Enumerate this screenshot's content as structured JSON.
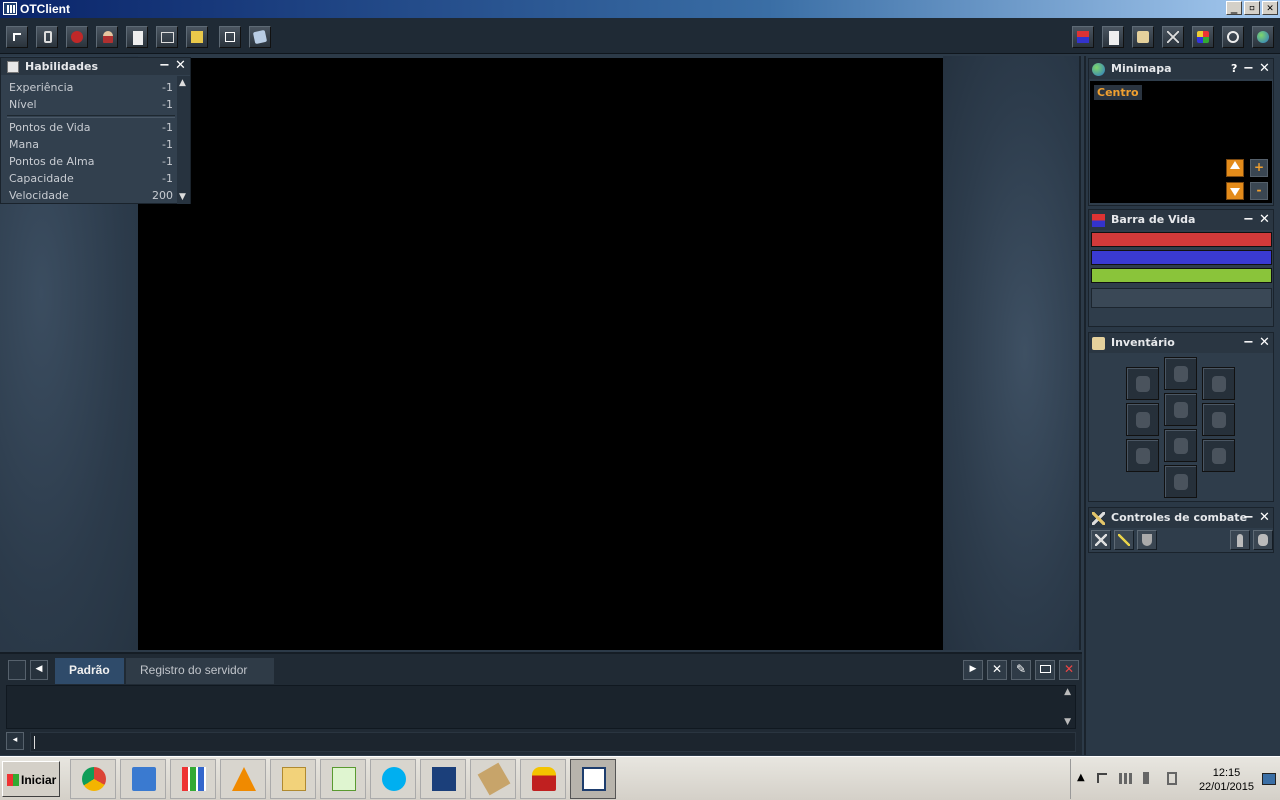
{
  "window": {
    "title": "OTClient",
    "controls": [
      "_",
      "▫",
      "✕"
    ]
  },
  "toolbar": {
    "left_buttons": [
      "pointer-icon",
      "hand-icon",
      "logout-icon",
      "character-icon",
      "notes-icon",
      "console-icon",
      "box-icon",
      "move-icon",
      "map-icon"
    ],
    "right_buttons": [
      "health-bar-icon",
      "skills-icon",
      "inventory-icon",
      "combat-icon",
      "spells-icon",
      "options-icon",
      "minimap-icon"
    ]
  },
  "skills_panel": {
    "title": "Habilidades",
    "rows": [
      {
        "label": "Experiência",
        "value": "-1"
      },
      {
        "label": "Nível",
        "value": "-1"
      },
      {
        "label": "Pontos de Vida",
        "value": "-1"
      },
      {
        "label": "Mana",
        "value": "-1"
      },
      {
        "label": "Pontos de Alma",
        "value": "-1"
      },
      {
        "label": "Capacidade",
        "value": "-1"
      },
      {
        "label": "Velocidade",
        "value": "200"
      }
    ]
  },
  "minimap": {
    "title": "Minimapa",
    "help": "?",
    "center_label": "Centro",
    "zoom_in": "+",
    "zoom_out": "-"
  },
  "health_bar": {
    "title": "Barra de Vida",
    "colors": {
      "health": "#d23a3a",
      "mana": "#3a3ad2",
      "soul": "#8ac43a"
    }
  },
  "inventory": {
    "title": "Inventário"
  },
  "combat": {
    "title": "Controles de combate"
  },
  "console": {
    "tabs": [
      {
        "label": "Padrão",
        "active": true
      },
      {
        "label": "Registro do servidor",
        "active": false
      }
    ]
  },
  "panel_controls": {
    "minimize": "−",
    "close": "✕"
  },
  "taskbar": {
    "start_label": "Iniciar",
    "clock_time": "12:15",
    "clock_date": "22/01/2015"
  }
}
